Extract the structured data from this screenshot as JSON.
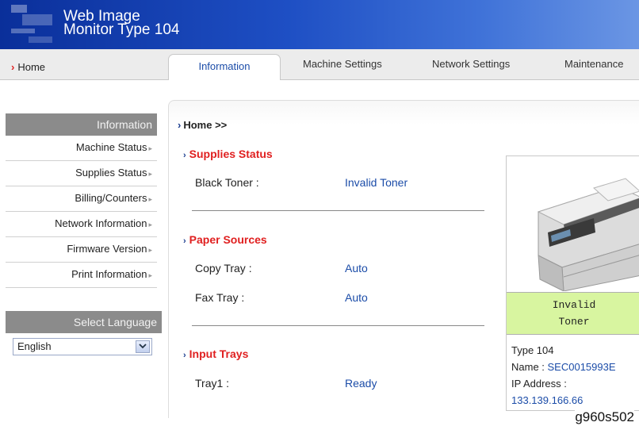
{
  "header": {
    "title_line1": "Web Image",
    "title_line2": "Monitor Type 104"
  },
  "nav": {
    "home_label": "Home",
    "tabs": [
      {
        "label": "Information",
        "active": true
      },
      {
        "label": "Machine Settings"
      },
      {
        "label": "Network Settings"
      },
      {
        "label": "Maintenance"
      }
    ]
  },
  "sidebar": {
    "header": "Information",
    "items": [
      {
        "label": "Machine Status"
      },
      {
        "label": "Supplies Status"
      },
      {
        "label": "Billing/Counters"
      },
      {
        "label": "Network Information"
      },
      {
        "label": "Firmware Version"
      },
      {
        "label": "Print Information"
      }
    ],
    "language_header": "Select Language",
    "language_value": "English"
  },
  "main": {
    "breadcrumb": "Home >>",
    "supplies": {
      "title": "Supplies Status",
      "rows": [
        {
          "label": "Black Toner :",
          "value": "Invalid Toner"
        }
      ]
    },
    "paper": {
      "title": "Paper Sources",
      "rows": [
        {
          "label": "Copy Tray :",
          "value": "Auto"
        },
        {
          "label": "Fax Tray :",
          "value": "Auto"
        }
      ]
    },
    "input": {
      "title": "Input Trays",
      "rows": [
        {
          "label": "Tray1 :",
          "value": "Ready"
        }
      ]
    }
  },
  "device": {
    "status_line1": "Invalid",
    "status_line2": "Toner",
    "model": "Type 104",
    "name_label": "Name : ",
    "name_value": "SEC0015993E",
    "ip_label": "IP Address :",
    "ip_value": "133.139.166.66"
  },
  "caption": "g960s502",
  "colors": {
    "banner": "#1e4fc4",
    "section_title": "#e02020",
    "link_value": "#1b4ca8",
    "status_bg": "#d8f5a0"
  }
}
